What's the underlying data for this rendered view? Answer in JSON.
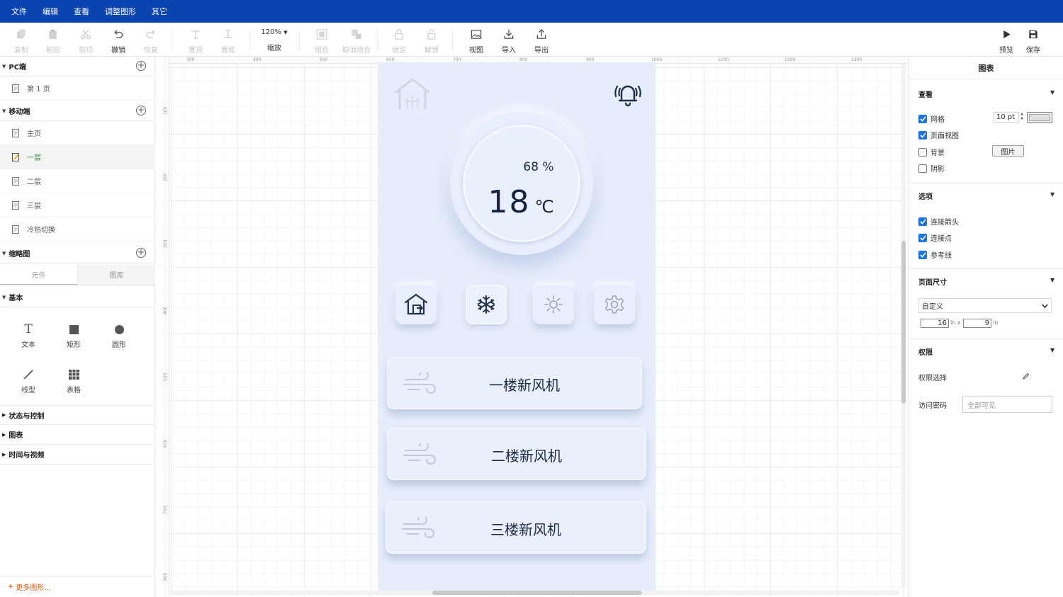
{
  "menubar": {
    "items": [
      "文件",
      "编辑",
      "查看",
      "调整图形",
      "其它"
    ]
  },
  "toolbar": {
    "copy": "复制",
    "paste": "粘贴",
    "cut": "剪切",
    "undo": "撤销",
    "redo": "恢复",
    "to_top": "置顶",
    "to_bottom": "置底",
    "zoom_value": "120%",
    "zoom_label": "缩放",
    "group": "组合",
    "ungroup": "取消组合",
    "lock": "锁定",
    "unlock": "解锁",
    "view": "视图",
    "import": "导入",
    "export": "导出",
    "preview": "预览",
    "save": "保存"
  },
  "left_panel": {
    "pc_section": "PC端",
    "pc_pages": [
      "第 1 页"
    ],
    "mobile_section": "移动端",
    "mobile_pages": [
      "主页",
      "一层",
      "二层",
      "三层",
      "冷热切换"
    ],
    "thumbnail_section": "缩略图",
    "tabs": [
      "元件",
      "图库"
    ],
    "basic_section": "基本",
    "shapes": [
      "文本",
      "矩形",
      "圆形",
      "线型",
      "表格"
    ],
    "categories": [
      "状态与控制",
      "图表",
      "时间与视频"
    ],
    "more_shapes": "更多图形..."
  },
  "ruler": {
    "top": [
      "300",
      "400",
      "500",
      "600",
      "700",
      "800",
      "900",
      "1000",
      "1100",
      "1200",
      "1300"
    ],
    "left": [
      "100",
      "200",
      "300",
      "400",
      "500",
      "600",
      "700",
      "800"
    ]
  },
  "phone": {
    "humidity": "68 %",
    "temperature": "18",
    "temperature_unit": "℃",
    "fans": [
      "一楼新风机",
      "二楼新风机",
      "三楼新风机"
    ],
    "icons": [
      "house-outline-icon",
      "alarm-bell-icon",
      "home-button-icon",
      "snowflake-icon",
      "sun-icon",
      "gear-icon",
      "wind-icon"
    ]
  },
  "right_panel": {
    "title": "图表",
    "view_section": "查看",
    "grid": "网格",
    "grid_size": "10 pt",
    "page_view": "页面视图",
    "background": "背景",
    "background_button": "图片",
    "shadow": "阴影",
    "options_section": "选项",
    "connect_arrow": "连接箭头",
    "connect_point": "连接点",
    "guide_line": "参考线",
    "page_size_section": "页面尺寸",
    "page_size_value": "自定义",
    "width_value": "16",
    "width_unit": "in x",
    "height_value": "9",
    "height_unit": "in",
    "permission_section": "权限",
    "permission_select": "权限选择",
    "access_password": "访问密码",
    "access_password_value": "全部可见"
  }
}
